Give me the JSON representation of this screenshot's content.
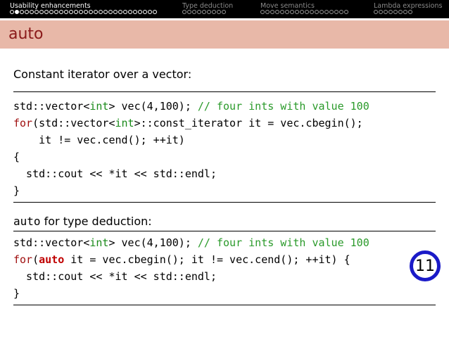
{
  "nav": {
    "sections": [
      {
        "label": "Usability enhancements",
        "dots": 30,
        "active_dot": 2
      },
      {
        "label": "Type deduction",
        "dots": 9,
        "active_dot": 0
      },
      {
        "label": "Move semantics",
        "dots": 18,
        "active_dot": 0
      },
      {
        "label": "Lambda expressions",
        "dots": 8,
        "active_dot": 0
      }
    ]
  },
  "slide": {
    "title": "auto",
    "caption1": "Constant iterator over a vector:",
    "caption2_code": "auto",
    "caption2_text": " for type deduction:",
    "badge": "11"
  },
  "colors": {
    "keyword": "#a01010",
    "type": "#1a8a1a",
    "comment": "#2a9a2a",
    "auto": "#c00000",
    "badge_ring": "#1a1ac8"
  }
}
